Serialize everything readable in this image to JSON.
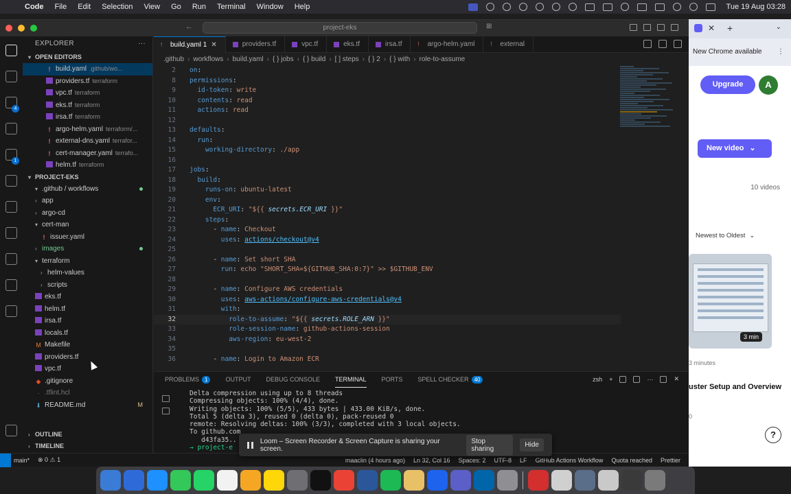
{
  "menubar": {
    "items": [
      "Code",
      "File",
      "Edit",
      "Selection",
      "View",
      "Go",
      "Run",
      "Terminal",
      "Window",
      "Help"
    ],
    "clock": "Tue 19 Aug  03:28"
  },
  "window": {
    "title": "project-eks"
  },
  "explorer": {
    "title": "EXPLORER",
    "open_editors_label": "OPEN EDITORS",
    "open_editors": [
      {
        "name": "build.yaml",
        "detail": ".github/wo...",
        "type": "yaml",
        "selected": true
      },
      {
        "name": "providers.tf",
        "detail": "terraform",
        "type": "tf"
      },
      {
        "name": "vpc.tf",
        "detail": "terraform",
        "type": "tf"
      },
      {
        "name": "eks.tf",
        "detail": "terraform",
        "type": "tf"
      },
      {
        "name": "irsa.tf",
        "detail": "terraform",
        "type": "tf"
      },
      {
        "name": "argo-helm.yaml",
        "detail": "terraform/...",
        "type": "yaml"
      },
      {
        "name": "external-dns.yaml",
        "detail": "terrafor...",
        "type": "yaml"
      },
      {
        "name": "cert-manager.yaml",
        "detail": "terrafo...",
        "type": "yaml"
      },
      {
        "name": "helm.tf",
        "detail": "terraform",
        "type": "tf"
      }
    ],
    "project_label": "PROJECT-EKS",
    "tree": [
      {
        "name": ".github / workflows",
        "indent": 1,
        "chev": "v",
        "dot": true
      },
      {
        "name": "app",
        "indent": 1,
        "chev": ">"
      },
      {
        "name": "argo-cd",
        "indent": 1,
        "chev": ">"
      },
      {
        "name": "cert-man",
        "indent": 1,
        "chev": "v"
      },
      {
        "name": "issuer.yaml",
        "indent": 2,
        "type": "yaml"
      },
      {
        "name": "images",
        "indent": 1,
        "chev": ">",
        "git": true,
        "dot": true
      },
      {
        "name": "terraform",
        "indent": 1,
        "chev": "v"
      },
      {
        "name": "helm-values",
        "indent": 2,
        "chev": ">"
      },
      {
        "name": "scripts",
        "indent": 2,
        "chev": ">"
      },
      {
        "name": "eks.tf",
        "indent": 1,
        "type": "tf"
      },
      {
        "name": "helm.tf",
        "indent": 1,
        "type": "tf"
      },
      {
        "name": "irsa.tf",
        "indent": 1,
        "type": "tf"
      },
      {
        "name": "locals.tf",
        "indent": 1,
        "type": "tf"
      },
      {
        "name": "Makefile",
        "indent": 1,
        "type": "make"
      },
      {
        "name": "providers.tf",
        "indent": 1,
        "type": "tf"
      },
      {
        "name": "vpc.tf",
        "indent": 1,
        "type": "tf"
      },
      {
        "name": ".gitignore",
        "indent": 1,
        "type": "git"
      },
      {
        "name": ".tflint.hcl",
        "indent": 1,
        "type": "dim"
      },
      {
        "name": "README.md",
        "indent": 1,
        "type": "md",
        "flag": "M"
      }
    ],
    "outline_label": "OUTLINE",
    "timeline_label": "TIMELINE"
  },
  "tabs": [
    {
      "name": "build.yaml 1",
      "type": "yaml",
      "active": true
    },
    {
      "name": "providers.tf",
      "type": "tf"
    },
    {
      "name": "vpc.tf",
      "type": "tf"
    },
    {
      "name": "eks.tf",
      "type": "tf"
    },
    {
      "name": "irsa.tf",
      "type": "tf"
    },
    {
      "name": "argo-helm.yaml",
      "type": "yaml"
    },
    {
      "name": "external",
      "type": "yaml"
    }
  ],
  "breadcrumb": [
    ".github",
    "workflows",
    "build.yaml",
    "{ } jobs",
    "{ } build",
    "[ ] steps",
    "{ } 2",
    "{ } with",
    "role-to-assume"
  ],
  "code": [
    {
      "n": "2",
      "t": "on:"
    },
    {
      "n": "8",
      "t": "permissions:"
    },
    {
      "n": "9",
      "t": "  id-token: write"
    },
    {
      "n": "10",
      "t": "  contents: read"
    },
    {
      "n": "11",
      "t": "  actions: read"
    },
    {
      "n": "12",
      "t": ""
    },
    {
      "n": "13",
      "t": "defaults:"
    },
    {
      "n": "14",
      "t": "  run:"
    },
    {
      "n": "15",
      "t": "    working-directory: ./app"
    },
    {
      "n": "16",
      "t": ""
    },
    {
      "n": "17",
      "t": "jobs:"
    },
    {
      "n": "18",
      "t": "  build:"
    },
    {
      "n": "19",
      "t": "    runs-on: ubuntu-latest"
    },
    {
      "n": "20",
      "t": "    env:"
    },
    {
      "n": "21",
      "t": "      ECR_URI: \"${{ secrets.ECR_URI }}\""
    },
    {
      "n": "22",
      "t": "    steps:"
    },
    {
      "n": "23",
      "t": "      - name: Checkout"
    },
    {
      "n": "24",
      "t": "        uses: actions/checkout@v4"
    },
    {
      "n": "25",
      "t": ""
    },
    {
      "n": "26",
      "t": "      - name: Set short SHA"
    },
    {
      "n": "27",
      "t": "        run: echo \"SHORT_SHA=${GITHUB_SHA:0:7}\" >> $GITHUB_ENV"
    },
    {
      "n": "28",
      "t": ""
    },
    {
      "n": "29",
      "t": "      - name: Configure AWS credentials"
    },
    {
      "n": "30",
      "t": "        uses: aws-actions/configure-aws-credentials@v4"
    },
    {
      "n": "31",
      "t": "        with:"
    },
    {
      "n": "32",
      "t": "          role-to-assume: \"${{ secrets.ROLE_ARN }}\"",
      "current": true
    },
    {
      "n": "33",
      "t": "          role-session-name: github-actions-session"
    },
    {
      "n": "34",
      "t": "          aws-region: eu-west-2"
    },
    {
      "n": "35",
      "t": ""
    },
    {
      "n": "36",
      "t": "      - name: Login to Amazon ECR"
    }
  ],
  "panel": {
    "tabs": [
      {
        "label": "PROBLEMS",
        "badge": "1"
      },
      {
        "label": "OUTPUT"
      },
      {
        "label": "DEBUG CONSOLE"
      },
      {
        "label": "TERMINAL",
        "active": true
      },
      {
        "label": "PORTS"
      },
      {
        "label": "SPELL CHECKER",
        "badge": "40"
      }
    ],
    "shell": "zsh",
    "terminal_lines": [
      "Delta compression using up to 8 threads",
      "Compressing objects: 100% (4/4), done.",
      "Writing objects: 100% (5/5), 433 bytes | 433.00 KiB/s, done.",
      "Total 5 (delta 3), reused 0 (delta 0), pack-reused 0",
      "remote: Resolving deltas: 100% (3/3), completed with 3 local objects.",
      "To github.com",
      "   d43fa35..",
      "→ project-e"
    ]
  },
  "statusbar": {
    "branch": "main*",
    "problems": "⊗ 0 ⚠ 1",
    "git_info": "maaclin (4 hours ago)",
    "position": "Ln 32, Col 16",
    "spaces": "Spaces: 2",
    "encoding": "UTF-8",
    "eol": "LF",
    "language": "GitHub Actions Workflow",
    "quota": "Quota reached",
    "formatter": "Prettier"
  },
  "loom": {
    "message": "Loom – Screen Recorder & Screen Capture is sharing your screen.",
    "stop_label": "Stop sharing",
    "hide_label": "Hide"
  },
  "chrome": {
    "banner": "New Chrome available",
    "upgrade_label": "Upgrade",
    "avatar_letter": "A",
    "new_video_label": "New video",
    "videos_count": "10 videos",
    "sort_label": "Newest to Oldest",
    "duration": "3 min",
    "video_time": "3 minutes",
    "video_title": "uster Setup and Overview",
    "video_views": "0",
    "help_label": "?"
  },
  "colors": {
    "accent": "#0078d4",
    "loom_purple": "#625df5",
    "status_bg": "#181818"
  }
}
